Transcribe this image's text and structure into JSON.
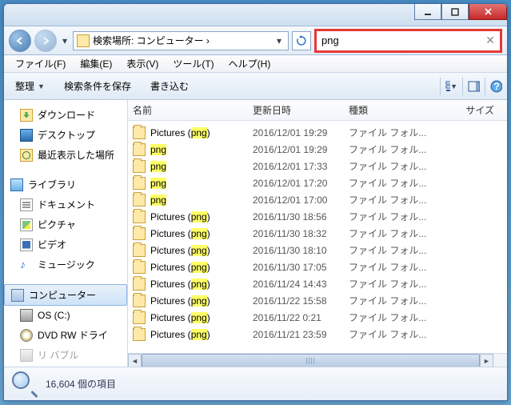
{
  "titlebar": {},
  "nav": {
    "address_text": "検索場所: コンピューター ›",
    "search_value": "png"
  },
  "menu": {
    "file": "ファイル(F)",
    "edit": "編集(E)",
    "view": "表示(V)",
    "tools": "ツール(T)",
    "help": "ヘルプ(H)"
  },
  "toolbar": {
    "organize": "整理",
    "save_search": "検索条件を保存",
    "burn": "書き込む"
  },
  "sidebar": {
    "downloads": "ダウンロード",
    "desktop": "デスクトップ",
    "recent": "最近表示した場所",
    "libraries": "ライブラリ",
    "documents": "ドキュメント",
    "pictures": "ピクチャ",
    "videos": "ビデオ",
    "music": "ミュージック",
    "computer": "コンピューター",
    "osc": "OS (C:)",
    "dvd": "DVD RW ドライ",
    "removable_trunc": "リ    バブル"
  },
  "columns": {
    "name": "名前",
    "date": "更新日時",
    "type": "種類",
    "size": "サイズ"
  },
  "labels": {
    "pictures_prefix": "Pictures (",
    "pictures_suffix": ")"
  },
  "rows": [
    {
      "name_pre": "Pictures (",
      "hl": "png",
      "name_post": ")",
      "date": "2016/12/01 19:29",
      "type": "ファイル フォル..."
    },
    {
      "name_pre": "",
      "hl": "png",
      "name_post": "",
      "date": "2016/12/01 19:29",
      "type": "ファイル フォル..."
    },
    {
      "name_pre": "",
      "hl": "png",
      "name_post": "",
      "date": "2016/12/01 17:33",
      "type": "ファイル フォル..."
    },
    {
      "name_pre": "",
      "hl": "png",
      "name_post": "",
      "date": "2016/12/01 17:20",
      "type": "ファイル フォル..."
    },
    {
      "name_pre": "",
      "hl": "png",
      "name_post": "",
      "date": "2016/12/01 17:00",
      "type": "ファイル フォル..."
    },
    {
      "name_pre": "Pictures (",
      "hl": "png",
      "name_post": ")",
      "date": "2016/11/30 18:56",
      "type": "ファイル フォル..."
    },
    {
      "name_pre": "Pictures (",
      "hl": "png",
      "name_post": ")",
      "date": "2016/11/30 18:32",
      "type": "ファイル フォル..."
    },
    {
      "name_pre": "Pictures (",
      "hl": "png",
      "name_post": ")",
      "date": "2016/11/30 18:10",
      "type": "ファイル フォル..."
    },
    {
      "name_pre": "Pictures (",
      "hl": "png",
      "name_post": ")",
      "date": "2016/11/30 17:05",
      "type": "ファイル フォル..."
    },
    {
      "name_pre": "Pictures (",
      "hl": "png",
      "name_post": ")",
      "date": "2016/11/24 14:43",
      "type": "ファイル フォル..."
    },
    {
      "name_pre": "Pictures (",
      "hl": "png",
      "name_post": ")",
      "date": "2016/11/22 15:58",
      "type": "ファイル フォル..."
    },
    {
      "name_pre": "Pictures (",
      "hl": "png",
      "name_post": ")",
      "date": "2016/11/22 0:21",
      "type": "ファイル フォル..."
    },
    {
      "name_pre": "Pictures (",
      "hl": "png",
      "name_post": ")",
      "date": "2016/11/21 23:59",
      "type": "ファイル フォル..."
    }
  ],
  "status": {
    "count_text": "16,604 個の項目"
  }
}
